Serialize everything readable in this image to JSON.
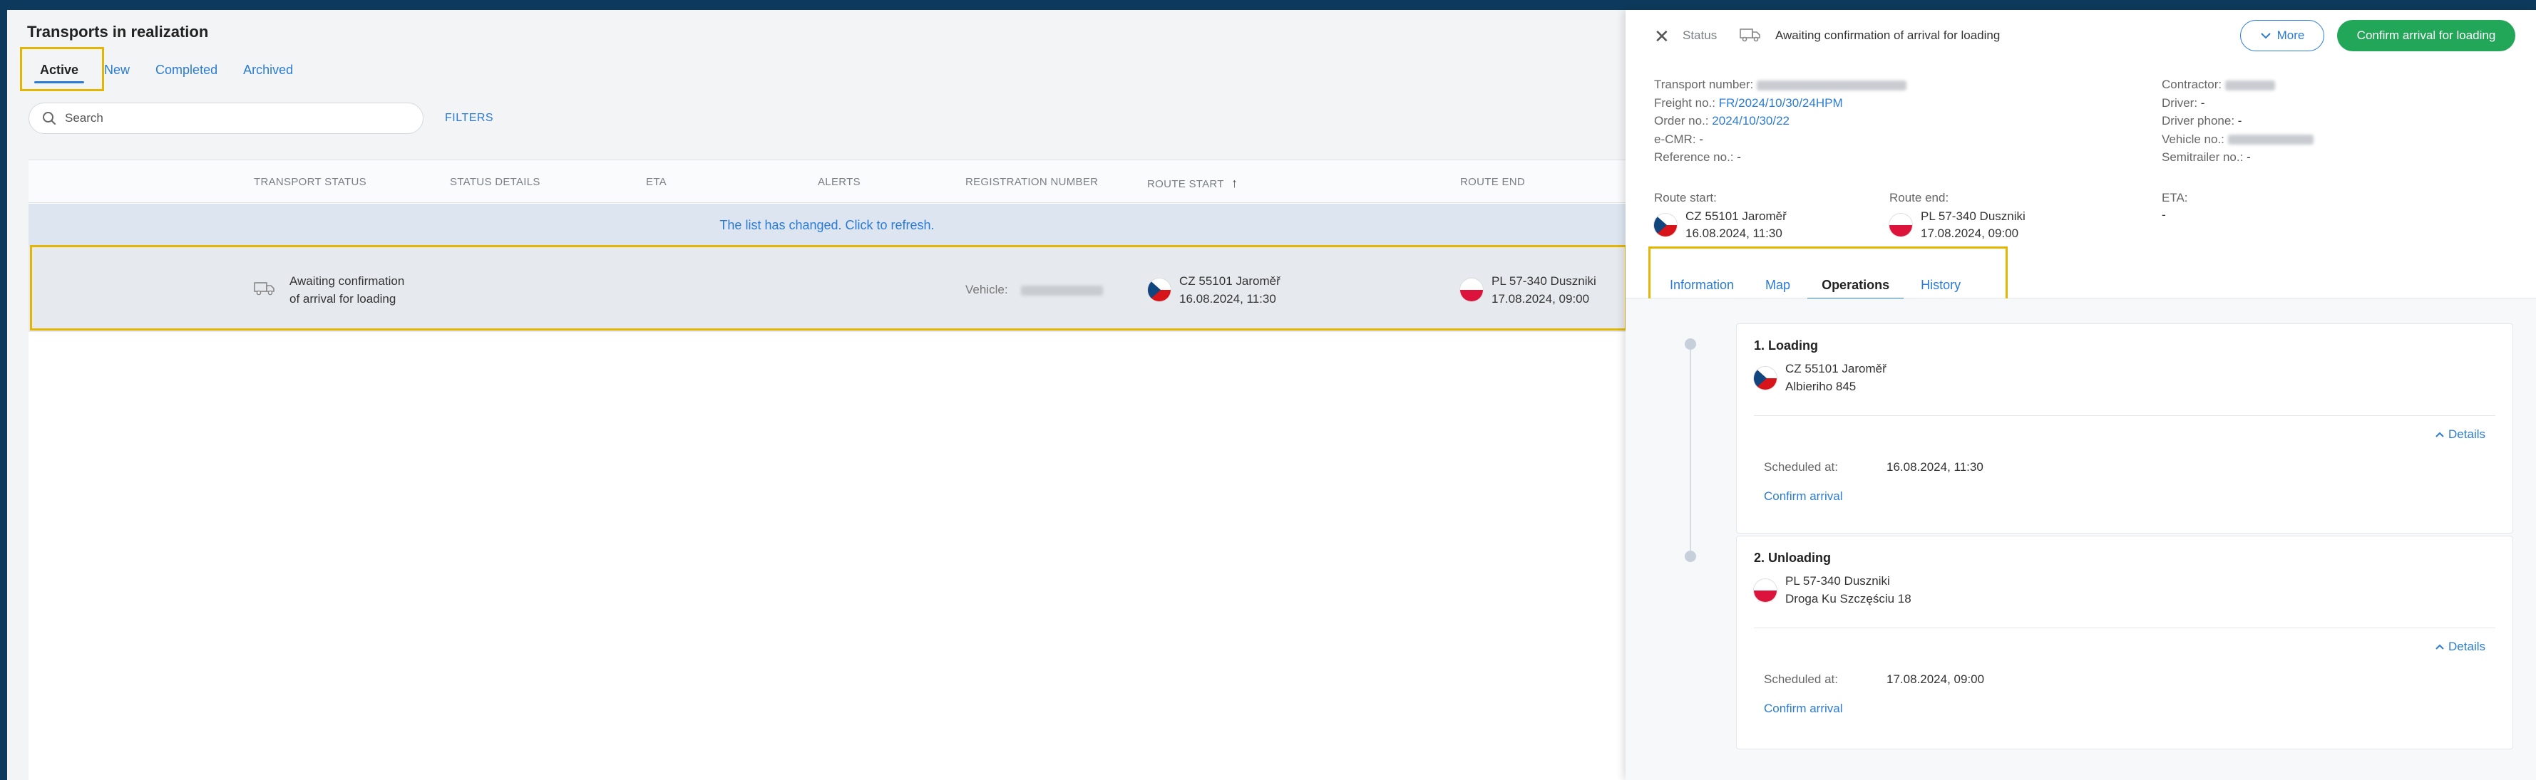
{
  "main": {
    "title": "Transports in realization",
    "tabs": [
      {
        "label": "Active"
      },
      {
        "label": "New"
      },
      {
        "label": "Completed"
      },
      {
        "label": "Archived"
      }
    ],
    "search_placeholder": "Search",
    "filters_label": "FILTERS",
    "columns": [
      "TRANSPORT STATUS",
      "STATUS DETAILS",
      "ETA",
      "ALERTS",
      "REGISTRATION NUMBER",
      "ROUTE START",
      "ROUTE END"
    ],
    "sort_indicator": "↑",
    "refresh_notice": "The list has changed. Click to refresh.",
    "row": {
      "status_line1": "Awaiting confirmation",
      "status_line2": "of arrival for loading",
      "vehicle_label": "Vehicle:",
      "route_start_place": "CZ 55101 Jaroměř",
      "route_start_date": "16.08.2024, 11:30",
      "route_end_place": "PL 57-340 Duszniki",
      "route_end_date": "17.08.2024, 09:00"
    }
  },
  "panel": {
    "close": "✕",
    "status_label": "Status",
    "status_text": "Awaiting confirmation of arrival for loading",
    "more_label": "More",
    "confirm_label": "Confirm arrival for loading",
    "info_left": [
      {
        "label": "Transport number:",
        "value": ""
      },
      {
        "label": "Freight no.:",
        "value": "FR/2024/10/30/24HPM"
      },
      {
        "label": "Order no.:",
        "value": "2024/10/30/22"
      },
      {
        "label": "e-CMR:",
        "value": "-"
      },
      {
        "label": "Reference no.:",
        "value": "-"
      }
    ],
    "info_right": [
      {
        "label": "Contractor:",
        "value": ""
      },
      {
        "label": "Driver:",
        "value": "-"
      },
      {
        "label": "Driver phone:",
        "value": "-"
      },
      {
        "label": "Vehicle no.:",
        "value": ""
      },
      {
        "label": "Semitrailer no.:",
        "value": "-"
      }
    ],
    "route_start_label": "Route start:",
    "route_start_place": "CZ 55101 Jaroměř",
    "route_start_date": "16.08.2024, 11:30",
    "route_end_label": "Route end:",
    "route_end_place": "PL 57-340 Duszniki",
    "route_end_date": "17.08.2024, 09:00",
    "eta_label": "ETA:",
    "eta_value": "-",
    "tabs": [
      {
        "label": "Information"
      },
      {
        "label": "Map"
      },
      {
        "label": "Operations"
      },
      {
        "label": "History"
      }
    ],
    "operations": [
      {
        "title": "1. Loading",
        "place": "CZ 55101 Jaroměř",
        "street": "Albieriho 845",
        "details_label": "Details",
        "scheduled_label": "Scheduled at:",
        "scheduled_value": "16.08.2024, 11:30",
        "confirm_label": "Confirm arrival"
      },
      {
        "title": "2. Unloading",
        "place": "PL 57-340 Duszniki",
        "street": "Droga Ku Szczęściu 18",
        "details_label": "Details",
        "scheduled_label": "Scheduled at:",
        "scheduled_value": "17.08.2024, 09:00",
        "confirm_label": "Confirm arrival"
      }
    ]
  },
  "colors": {
    "accent": "#2b7bd3",
    "confirm_green": "#22a658",
    "highlight": "#e3b505"
  }
}
